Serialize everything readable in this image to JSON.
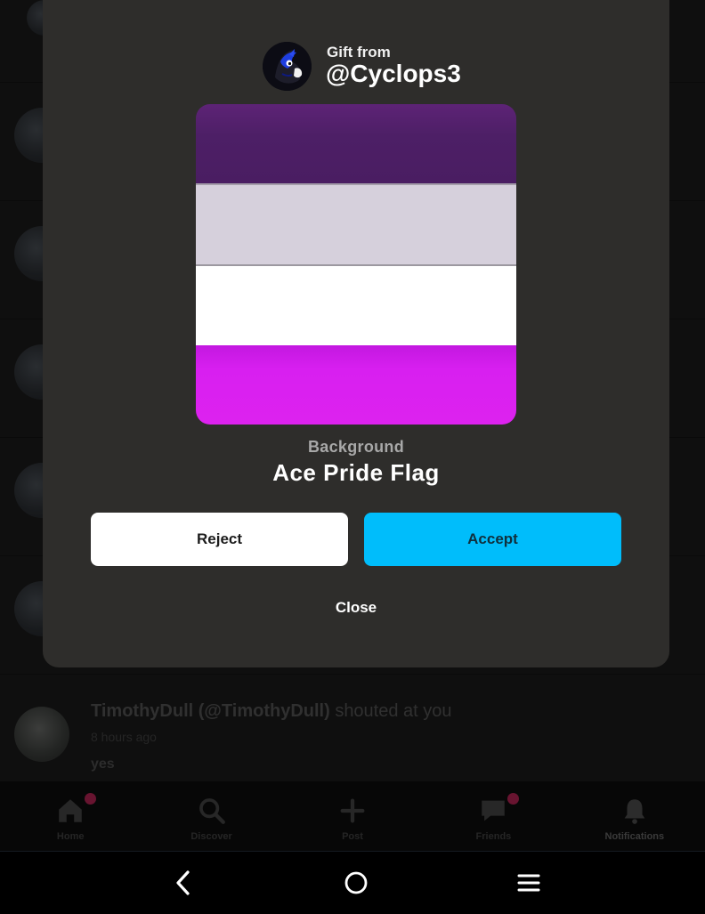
{
  "background_app": {
    "last_notification": {
      "actor_name": "TimothyDull (@TimothyDull)",
      "action": "shouted at you",
      "time": "8 hours ago",
      "message": "yes"
    },
    "tabs": [
      {
        "label": "Home",
        "icon": "home-icon",
        "badge": true
      },
      {
        "label": "Discover",
        "icon": "search-icon",
        "badge": false
      },
      {
        "label": "Post",
        "icon": "plus-icon",
        "badge": false
      },
      {
        "label": "Friends",
        "icon": "chat-icon",
        "badge": true
      },
      {
        "label": "Notifications",
        "icon": "bell-icon",
        "badge": false
      }
    ]
  },
  "gift_modal": {
    "gift_from_label": "Gift from",
    "username": "@Cyclops3",
    "item_type": "Background",
    "item_name": "Ace Pride Flag",
    "flag_colors": [
      "#4d1f66",
      "#d6d0dc",
      "#ffffff",
      "#d81ff0"
    ],
    "reject_label": "Reject",
    "accept_label": "Accept",
    "close_label": "Close",
    "accept_color": "#00bdfb"
  },
  "system_nav": {
    "buttons": [
      "back-icon",
      "home-circle-icon",
      "menu-icon"
    ]
  }
}
